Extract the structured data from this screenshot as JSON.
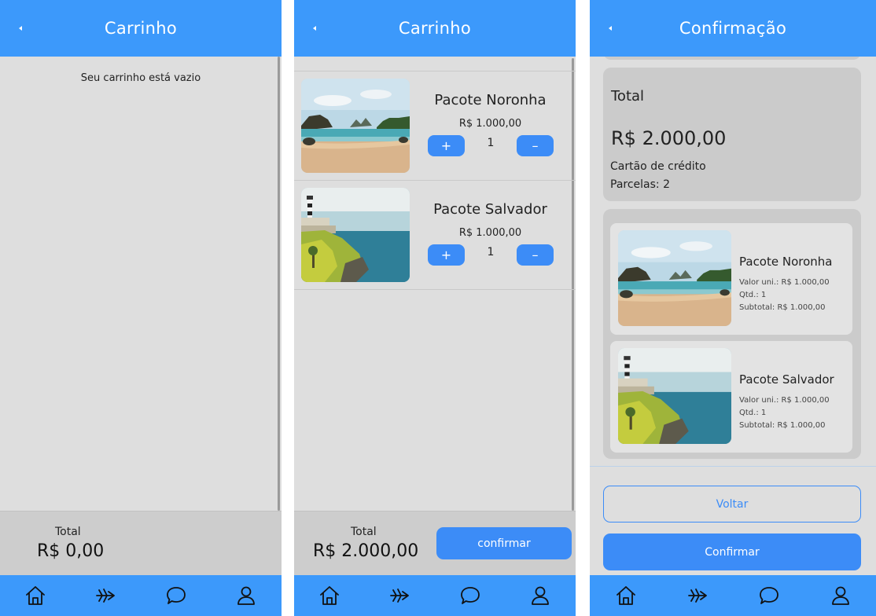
{
  "colors": {
    "accent": "#3c99fb",
    "button": "#3c8cf7",
    "background": "#dedede"
  },
  "nav_icons": [
    "home-icon",
    "plane-icon",
    "chat-icon",
    "profile-icon"
  ],
  "screen_empty": {
    "title": "Carrinho",
    "empty_message": "Seu carrinho está vazio",
    "total_label": "Total",
    "total_value": "R$ 0,00"
  },
  "screen_cart": {
    "title": "Carrinho",
    "items": [
      {
        "name": "Pacote Noronha",
        "price": "R$ 1.000,00",
        "qty": "1",
        "plus": "+",
        "minus": "–",
        "image": "beach-image"
      },
      {
        "name": "Pacote Salvador",
        "price": "R$ 1.000,00",
        "qty": "1",
        "plus": "+",
        "minus": "–",
        "image": "lighthouse-image"
      }
    ],
    "total_label": "Total",
    "total_value": "R$ 2.000,00",
    "confirm_label": "confirmar"
  },
  "screen_confirm": {
    "title": "Confirmação",
    "total_label": "Total",
    "total_value": "R$ 2.000,00",
    "payment": "Cartão de crédito",
    "installments": "Parcelas: 2",
    "items": [
      {
        "name": "Pacote Noronha",
        "unit": "Valor uni.: R$ 1.000,00",
        "qty": "Qtd.: 1",
        "subtotal": "Subtotal: R$ 1.000,00"
      },
      {
        "name": "Pacote Salvador",
        "unit": "Valor uni.: R$ 1.000,00",
        "qty": "Qtd.: 1",
        "subtotal": "Subtotal: R$ 1.000,00"
      }
    ],
    "back_label": "Voltar",
    "confirm_label": "Confirmar"
  }
}
